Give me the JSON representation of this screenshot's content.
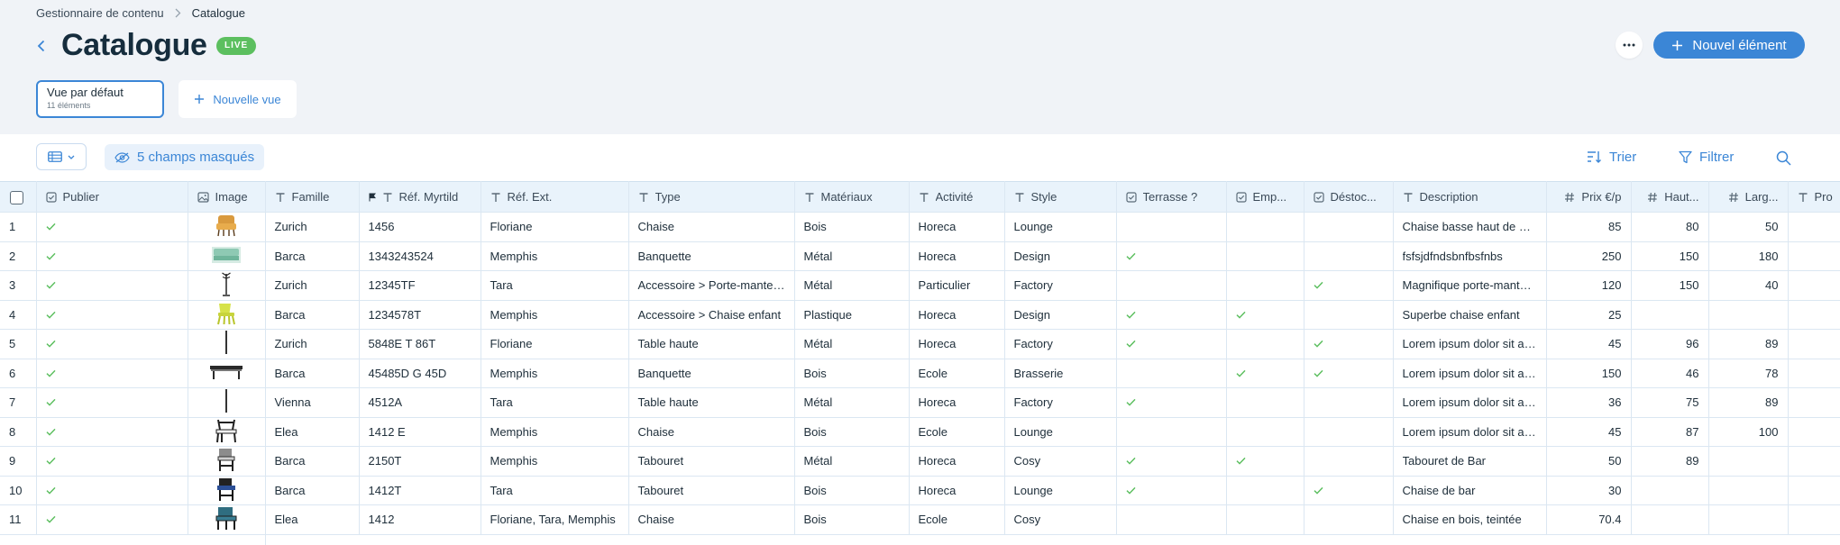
{
  "breadcrumb": {
    "parent": "Gestionnaire de contenu",
    "current": "Catalogue"
  },
  "header": {
    "title": "Catalogue",
    "badge": "LIVE",
    "new_item_label": "Nouvel élément"
  },
  "views": {
    "active_name": "Vue par défaut",
    "active_count": "11 éléments",
    "new_view_label": "Nouvelle vue"
  },
  "toolbar": {
    "hidden_fields": "5 champs masqués",
    "sort": "Trier",
    "filter": "Filtrer"
  },
  "columns": [
    {
      "label": "Publier",
      "icon": "checkbox-type-icon"
    },
    {
      "label": "Image",
      "icon": "image-type-icon"
    },
    {
      "label": "Famille",
      "icon": "text-type-icon"
    },
    {
      "label": "Réf. Myrtild",
      "icon": "text-type-icon",
      "pinned": true
    },
    {
      "label": "Réf. Ext.",
      "icon": "text-type-icon"
    },
    {
      "label": "Type",
      "icon": "text-type-icon"
    },
    {
      "label": "Matériaux",
      "icon": "text-type-icon"
    },
    {
      "label": "Activité",
      "icon": "text-type-icon"
    },
    {
      "label": "Style",
      "icon": "text-type-icon"
    },
    {
      "label": "Terrasse ?",
      "icon": "checkbox-type-icon"
    },
    {
      "label": "Emp...",
      "icon": "checkbox-type-icon"
    },
    {
      "label": "Déstoc...",
      "icon": "checkbox-type-icon"
    },
    {
      "label": "Description",
      "icon": "text-type-icon"
    },
    {
      "label": "Prix €/p",
      "icon": "number-type-icon"
    },
    {
      "label": "Haut...",
      "icon": "number-type-icon"
    },
    {
      "label": "Larg...",
      "icon": "number-type-icon"
    },
    {
      "label": "Pro",
      "icon": "text-type-icon"
    }
  ],
  "rows": [
    {
      "n": "1",
      "publier": true,
      "image": "armchair-orange",
      "famille": "Zurich",
      "ref": "1456",
      "ref_ext": "Floriane",
      "type": "Chaise",
      "materiaux": "Bois",
      "activite": "Horeca",
      "style": "Lounge",
      "terrasse": false,
      "emp": false,
      "destoc": false,
      "description": "Chaise basse haut de gamme",
      "prix": "85",
      "haut": "80",
      "larg": "50"
    },
    {
      "n": "2",
      "publier": true,
      "image": "bench-green",
      "famille": "Barca",
      "ref": "1343243524",
      "ref_ext": "Memphis",
      "type": "Banquette",
      "materiaux": "Métal",
      "activite": "Horeca",
      "style": "Design",
      "terrasse": true,
      "emp": false,
      "destoc": false,
      "description": "fsfsjdfndsbnfbsfnbs",
      "prix": "250",
      "haut": "150",
      "larg": "180"
    },
    {
      "n": "3",
      "publier": true,
      "image": "coat-rack",
      "famille": "Zurich",
      "ref": "12345TF",
      "ref_ext": "Tara",
      "type": "Accessoire > Porte-manteau",
      "materiaux": "Métal",
      "activite": "Particulier",
      "style": "Factory",
      "terrasse": false,
      "emp": false,
      "destoc": true,
      "description": "Magnifique porte-manteau",
      "prix": "120",
      "haut": "150",
      "larg": "40"
    },
    {
      "n": "4",
      "publier": true,
      "image": "kids-chair-yellow",
      "famille": "Barca",
      "ref": "1234578T",
      "ref_ext": "Memphis",
      "type": "Accessoire > Chaise enfant",
      "materiaux": "Plastique",
      "activite": "Horeca",
      "style": "Design",
      "terrasse": true,
      "emp": true,
      "destoc": false,
      "description": "Superbe chaise enfant",
      "prix": "25",
      "haut": "",
      "larg": ""
    },
    {
      "n": "5",
      "publier": true,
      "image": "high-table",
      "famille": "Zurich",
      "ref": "5848E T 86T",
      "ref_ext": "Floriane",
      "type": "Table haute",
      "materiaux": "Métal",
      "activite": "Horeca",
      "style": "Factory",
      "terrasse": true,
      "emp": false,
      "destoc": true,
      "description": "Lorem ipsum dolor sit amet",
      "prix": "45",
      "haut": "96",
      "larg": "89"
    },
    {
      "n": "6",
      "publier": true,
      "image": "bench-dark",
      "famille": "Barca",
      "ref": "45485D G 45D",
      "ref_ext": "Memphis",
      "type": "Banquette",
      "materiaux": "Bois",
      "activite": "Ecole",
      "style": "Brasserie",
      "terrasse": false,
      "emp": true,
      "destoc": true,
      "description": "Lorem ipsum dolor sit amet",
      "prix": "150",
      "haut": "46",
      "larg": "78"
    },
    {
      "n": "7",
      "publier": true,
      "image": "high-table",
      "famille": "Vienna",
      "ref": "4512A",
      "ref_ext": "Tara",
      "type": "Table haute",
      "materiaux": "Métal",
      "activite": "Horeca",
      "style": "Factory",
      "terrasse": true,
      "emp": false,
      "destoc": false,
      "description": "Lorem ipsum dolor sit amet",
      "prix": "36",
      "haut": "75",
      "larg": "89"
    },
    {
      "n": "8",
      "publier": true,
      "image": "chair-dark",
      "famille": "Elea",
      "ref": "1412 E",
      "ref_ext": "Memphis",
      "type": "Chaise",
      "materiaux": "Bois",
      "activite": "Ecole",
      "style": "Lounge",
      "terrasse": false,
      "emp": false,
      "destoc": false,
      "description": "Lorem ipsum dolor sit amet",
      "prix": "45",
      "haut": "87",
      "larg": "100"
    },
    {
      "n": "9",
      "publier": true,
      "image": "stool-grey",
      "famille": "Barca",
      "ref": "2150T",
      "ref_ext": "Memphis",
      "type": "Tabouret",
      "materiaux": "Métal",
      "activite": "Horeca",
      "style": "Cosy",
      "terrasse": true,
      "emp": true,
      "destoc": false,
      "description": "Tabouret de Bar",
      "prix": "50",
      "haut": "89",
      "larg": ""
    },
    {
      "n": "10",
      "publier": true,
      "image": "stool-blue",
      "famille": "Barca",
      "ref": "1412T",
      "ref_ext": "Tara",
      "type": "Tabouret",
      "materiaux": "Bois",
      "activite": "Horeca",
      "style": "Lounge",
      "terrasse": true,
      "emp": false,
      "destoc": true,
      "description": "Chaise de bar",
      "prix": "30",
      "haut": "",
      "larg": ""
    },
    {
      "n": "11",
      "publier": true,
      "image": "chair-teal",
      "famille": "Elea",
      "ref": "1412",
      "ref_ext": "Floriane, Tara, Memphis",
      "type": "Chaise",
      "materiaux": "Bois",
      "activite": "Ecole",
      "style": "Cosy",
      "terrasse": false,
      "emp": false,
      "destoc": false,
      "description": "Chaise en bois, teintée",
      "prix": "70.4",
      "haut": "",
      "larg": ""
    }
  ],
  "colors": {
    "accent": "#3b86d6",
    "live": "#5cbf5f",
    "check": "#5cbf5f",
    "header_bg": "#e9f3fb"
  }
}
